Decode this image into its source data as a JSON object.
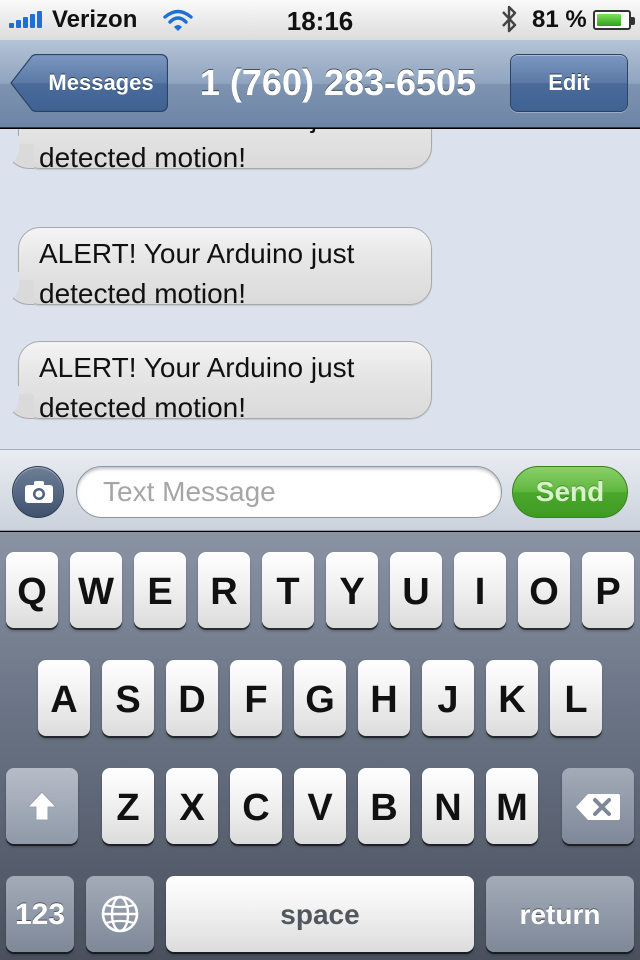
{
  "status_bar": {
    "carrier": "Verizon",
    "time": "18:16",
    "battery_percent": "81 %",
    "battery_level": 0.81,
    "signal_bars": 5
  },
  "nav": {
    "back_label": "Messages",
    "title": "1 (760) 283-6505",
    "edit_label": "Edit"
  },
  "messages": [
    {
      "text": "ALERT! Your Arduino just detected motion!"
    },
    {
      "text": "ALERT! Your Arduino just detected motion!"
    },
    {
      "text": "ALERT! Your Arduino just detected motion!"
    }
  ],
  "compose": {
    "placeholder": "Text Message",
    "send_label": "Send"
  },
  "keyboard": {
    "row1": [
      "Q",
      "W",
      "E",
      "R",
      "T",
      "Y",
      "U",
      "I",
      "O",
      "P"
    ],
    "row2": [
      "A",
      "S",
      "D",
      "F",
      "G",
      "H",
      "J",
      "K",
      "L"
    ],
    "row3": [
      "Z",
      "X",
      "C",
      "V",
      "B",
      "N",
      "M"
    ],
    "numbers_label": "123",
    "space_label": "space",
    "return_label": "return"
  },
  "colors": {
    "nav_blue": "#6d85a6",
    "send_green": "#4aa82b",
    "conversation_bg": "#dbe2ed",
    "signal_blue": "#1f6fd6"
  },
  "icons": {
    "wifi": "wifi-icon",
    "bluetooth": "bluetooth-icon",
    "camera": "camera-icon",
    "globe": "globe-icon",
    "shift": "shift-arrow-icon",
    "delete": "backspace-icon"
  }
}
